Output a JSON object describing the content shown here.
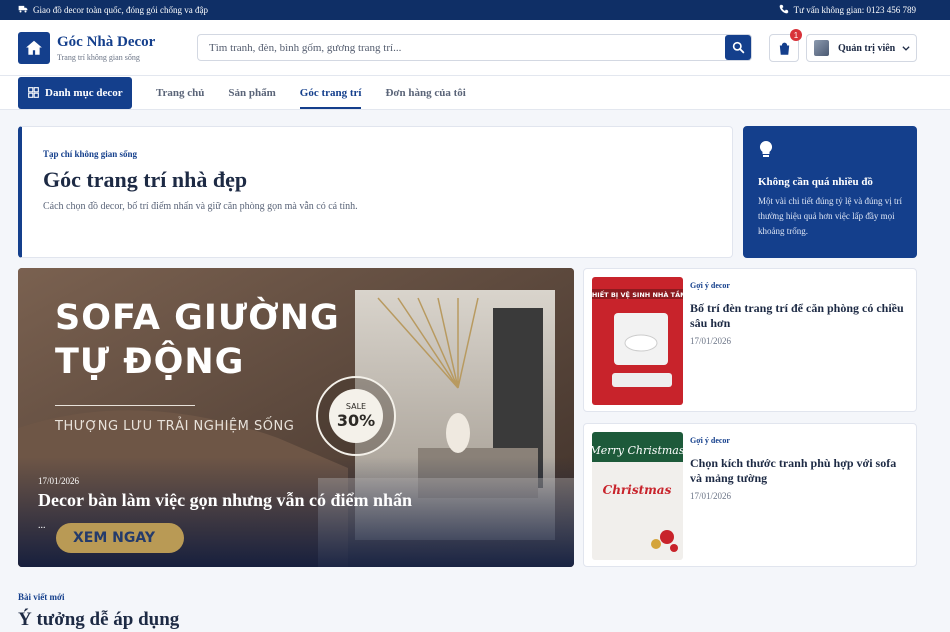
{
  "topbar": {
    "shipping": "Giao đồ decor toàn quốc, đóng gói chống va đập",
    "hotline": "Tư vấn không gian: 0123 456 789"
  },
  "header": {
    "brand_name": "Góc Nhà Decor",
    "brand_tagline": "Trang trí không gian sống",
    "search_placeholder": "Tìm tranh, đèn, bình gốm, gương trang trí...",
    "cart_count": "1",
    "account_label": "Quản trị viên"
  },
  "nav": {
    "category_button": "Danh mục decor",
    "items": [
      {
        "label": "Trang chủ",
        "active": false
      },
      {
        "label": "Sản phẩm",
        "active": false
      },
      {
        "label": "Góc trang trí",
        "active": true
      },
      {
        "label": "Đơn hàng của tôi",
        "active": false
      }
    ]
  },
  "hero": {
    "kicker": "Tạp chí không gian sống",
    "title": "Góc trang trí nhà đẹp",
    "description": "Cách chọn đồ decor, bố trí điểm nhấn và giữ căn phòng gọn mà vẫn có cá tính."
  },
  "tip": {
    "title": "Không cần quá nhiều đồ",
    "text": "Một vài chi tiết đúng tỷ lệ và đúng vị trí thường hiệu quả hơn việc lấp đầy mọi khoảng trống."
  },
  "featured": {
    "image_text_line1": "SOFA GIƯỜNG",
    "image_text_line2": "TỰ ĐỘNG",
    "image_subtext": "THƯỢNG LƯU TRẢI NGHIỆM SỐNG",
    "sale_label": "SALE",
    "sale_value": "30%",
    "cta_label": "XEM NGAY",
    "date": "17/01/2026",
    "title": "Decor bàn làm việc gọn nhưng vẫn có điểm nhấn",
    "excerpt": "..."
  },
  "side_posts": [
    {
      "category": "Gợi ý decor",
      "title": "Bố trí đèn trang trí để căn phòng có chiều sâu hơn",
      "date": "17/01/2026",
      "image_caption": "THIẾT BỊ VỆ SINH NHÀ TẮM"
    },
    {
      "category": "Gợi ý decor",
      "title": "Chọn kích thước tranh phù hợp với sofa và mảng tường",
      "date": "17/01/2026",
      "image_caption": "Merry Christmas"
    }
  ],
  "latest": {
    "kicker": "Bài viết mới",
    "heading": "Ý tưởng dễ áp dụng"
  },
  "colors": {
    "primary": "#143f8c",
    "topbar": "#0f2f66",
    "badge": "#d8323a"
  }
}
